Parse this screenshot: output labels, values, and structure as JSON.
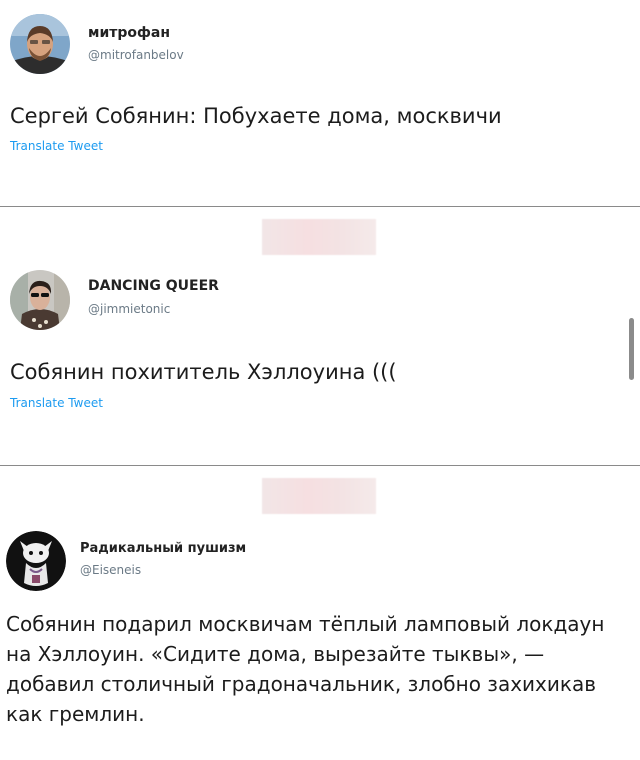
{
  "tweets": [
    {
      "name": "митрофан",
      "handle": "@mitrofanbelov",
      "text": "Сергей Собянин: Побухаете дома, москвичи",
      "translate": "Translate Tweet"
    },
    {
      "name": "DANCING QUEER",
      "handle": "@jimmietonic",
      "text": "Собянин похититель Хэллоуина (((",
      "translate": "Translate Tweet"
    },
    {
      "name": "Радикальный пушизм",
      "handle": "@Eiseneis",
      "text": "Собянин подарил москвичам тёплый ламповый локдаун на Хэллоуин. «Сидите дома, вырезайте тыквы», — добавил столичный градоначальник, злобно захихикав как гремлин."
    }
  ],
  "colors": {
    "link": "#1d9bf0",
    "handle": "#6b7a86",
    "divider": "#8a8a8a",
    "censor": "#f4e2e3"
  },
  "icons": [
    "avatar-photo",
    "avatar-photo",
    "avatar-drawing"
  ]
}
